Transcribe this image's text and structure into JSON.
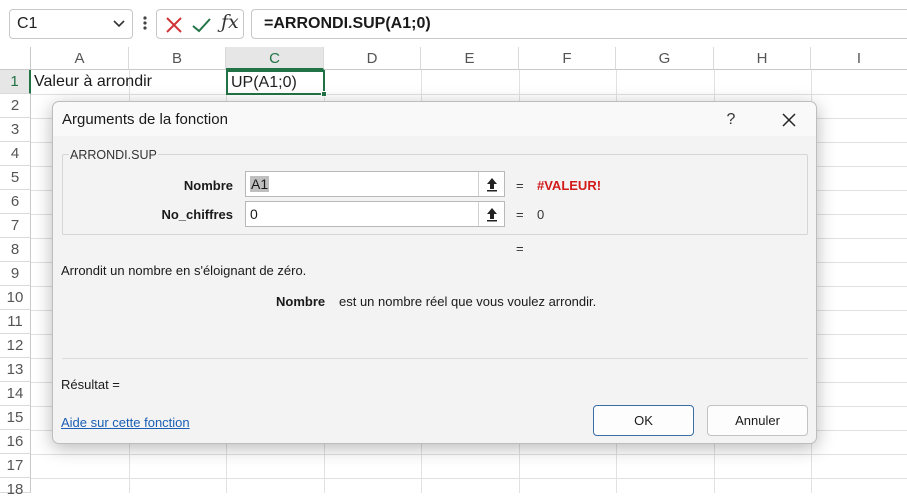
{
  "formula_bar": {
    "name_box": "C1",
    "formula": "=ARRONDI.SUP(A1;0)"
  },
  "grid": {
    "columns": [
      "A",
      "B",
      "C",
      "D",
      "E",
      "F",
      "G",
      "H",
      "I"
    ],
    "selected_column": "C",
    "rows": [
      "1",
      "2",
      "3",
      "4",
      "5",
      "6",
      "7",
      "8",
      "9",
      "10",
      "11",
      "12",
      "13",
      "14",
      "15",
      "16",
      "17",
      "18"
    ],
    "selected_row": "1",
    "cells": {
      "A1": "Valeur à arrondir",
      "C1": "UP(A1;0)"
    }
  },
  "dialog": {
    "title": "Arguments de la fonction",
    "help_label": "?",
    "function_name": "ARRONDI.SUP",
    "args": [
      {
        "label": "Nombre",
        "value": "A1",
        "equals": "=",
        "result": "#VALEUR!"
      },
      {
        "label": "No_chiffres",
        "value": "0",
        "equals": "=",
        "result": "0"
      }
    ],
    "overall_equals": "=",
    "description": "Arrondit un nombre en s'éloignant de zéro.",
    "arg_help_name": "Nombre",
    "arg_help_text": "est un nombre réel que vous voulez arrondir.",
    "result_label": "Résultat =",
    "help_link": "Aide sur cette fonction",
    "ok_label": "OK",
    "cancel_label": "Annuler"
  },
  "colors": {
    "accent_green": "#217346",
    "error_red": "#d21b1b",
    "link_blue": "#1a5fb4"
  }
}
